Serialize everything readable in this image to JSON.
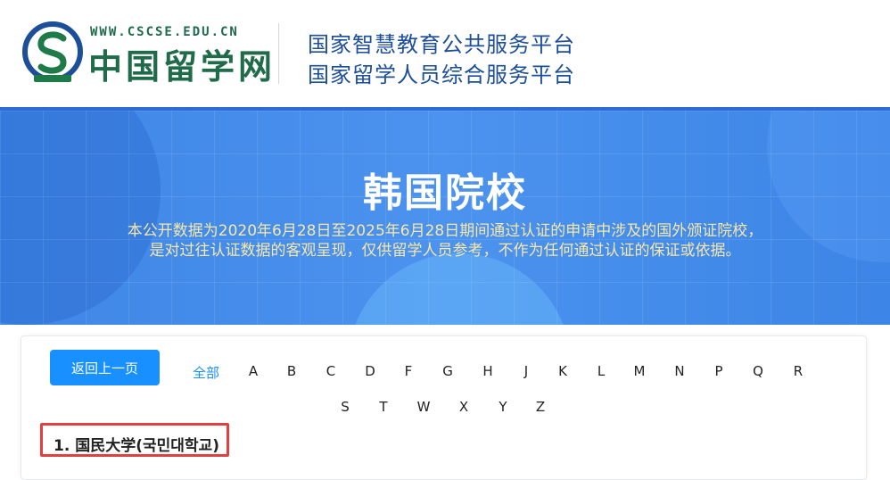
{
  "header": {
    "site_url": "WWW.CSCSE.EDU.CN",
    "site_name": "中国留学网",
    "platform_line1": "国家智慧教育公共服务平台",
    "platform_line2": "国家留学人员综合服务平台",
    "logo_icon": "cscse-logo-icon",
    "brand_color": "#1f6b4a",
    "accent_color": "#1d4e9a"
  },
  "banner": {
    "title": "韩国院校",
    "desc_line1": "本公开数据为2020年6月28日至2025年6月28日期间通过认证的申请中涉及的国外颁证院校，",
    "desc_line2": "是对过往认证数据的客观呈现，仅供留学人员参考，不作为任何通过认证的保证或依据。",
    "desc_color": "#f7e7a8"
  },
  "nav": {
    "back_label": "返回上一页",
    "all_label": "全部",
    "letters_row1": [
      "A",
      "B",
      "C",
      "D",
      "F",
      "G",
      "H",
      "J",
      "K",
      "L",
      "M",
      "N",
      "P",
      "Q",
      "R"
    ],
    "letters_row2": [
      "S",
      "T",
      "W",
      "X",
      "Y",
      "Z"
    ],
    "active_color": "#1890ff"
  },
  "schools": [
    {
      "index": "1.",
      "name": "国民大学(국민대학교)"
    }
  ]
}
